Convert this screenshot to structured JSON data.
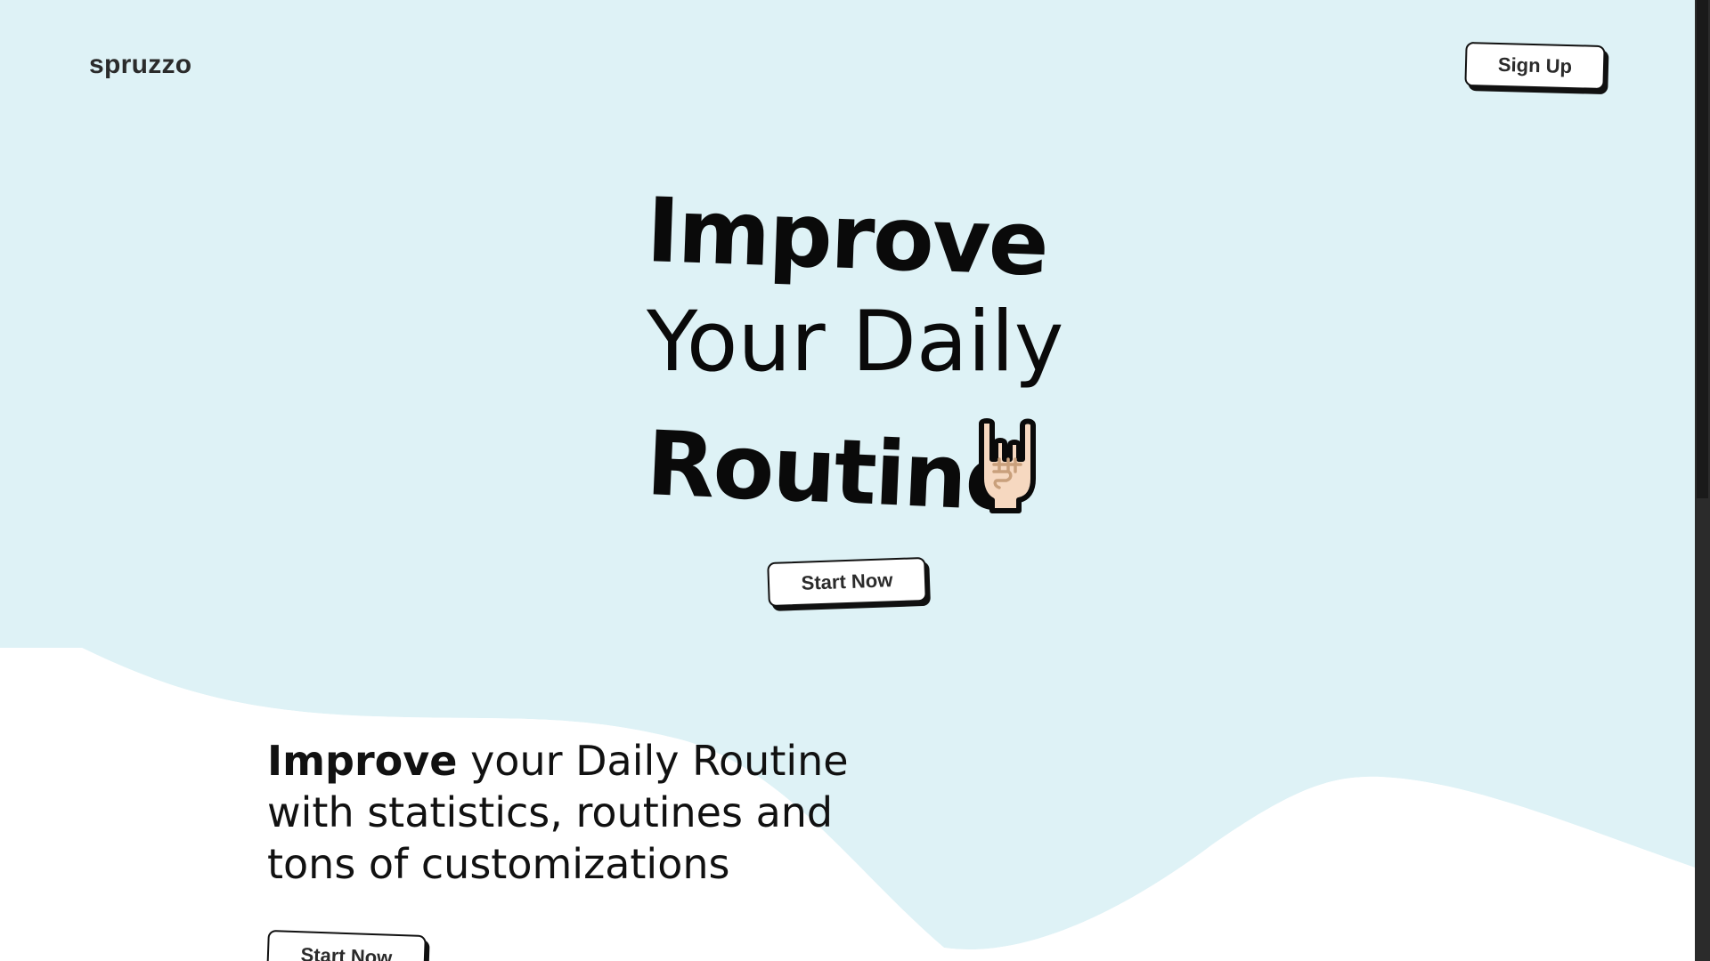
{
  "nav": {
    "logo": "spruzzo",
    "signup_label": "Sign Up"
  },
  "hero": {
    "line1": "Improve",
    "line2": "Your Daily",
    "line3": "Routine",
    "icon": "rock-on-hand-icon",
    "cta_label": "Start Now"
  },
  "features": {
    "text_bold": "Improve",
    "text_rest": " your Daily Routine with statistics, routines and tons of customizations",
    "cta_label": "Start Now"
  },
  "colors": {
    "hero_background": "#def2f6",
    "text": "#0a0a0a",
    "button_border": "#111111",
    "skin": "#f6d8c0",
    "skin_detail": "#c9a07c"
  }
}
